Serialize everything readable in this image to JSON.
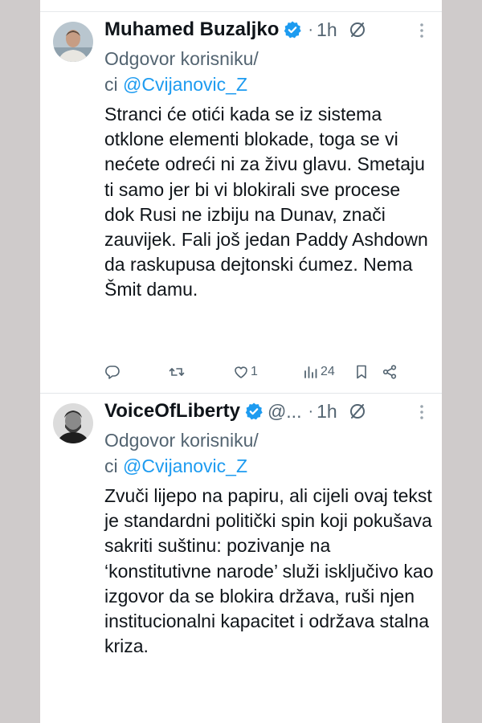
{
  "tweets": [
    {
      "name": "Muhamed Buzaljko",
      "handle": "",
      "dot": "·",
      "time": "1h",
      "reply_prefix_1": "Odgovor korisniku/",
      "reply_prefix_2": "ci ",
      "mention": "@Cvijanovic_Z",
      "text": "Stranci će otići kada se iz sistema otklone elementi blokade, toga se vi nećete odreći ni za živu glavu. Smetaju ti samo jer bi vi blokirali sve procese dok Rusi ne izbiju na Dunav, znači zauvijek. Fali još jedan Paddy Ashdown da raskupusa dejtonski ćumez. Nema Šmit damu.",
      "likes": "1",
      "views": "24"
    },
    {
      "name": "VoiceOfLiberty",
      "handle": "@...",
      "dot": "·",
      "time": "1h",
      "reply_prefix_1": "Odgovor korisniku/",
      "reply_prefix_2": "ci ",
      "mention": "@Cvijanovic_Z",
      "text": "Zvuči lijepo na papiru, ali cijeli ovaj tekst je standardni politički spin koji pokušava sakriti suštinu: pozivanje na ‘konstitutivne narode’ služi isključivo kao izgovor da se blokira država, ruši njen institucionalni kapacitet i održava stalna kriza."
    }
  ],
  "colors": {
    "verified": "#1d9bf0",
    "text": "#0f1419",
    "secondary": "#536471",
    "link": "#1d9bf0",
    "backdrop": "#cfcbcb"
  }
}
